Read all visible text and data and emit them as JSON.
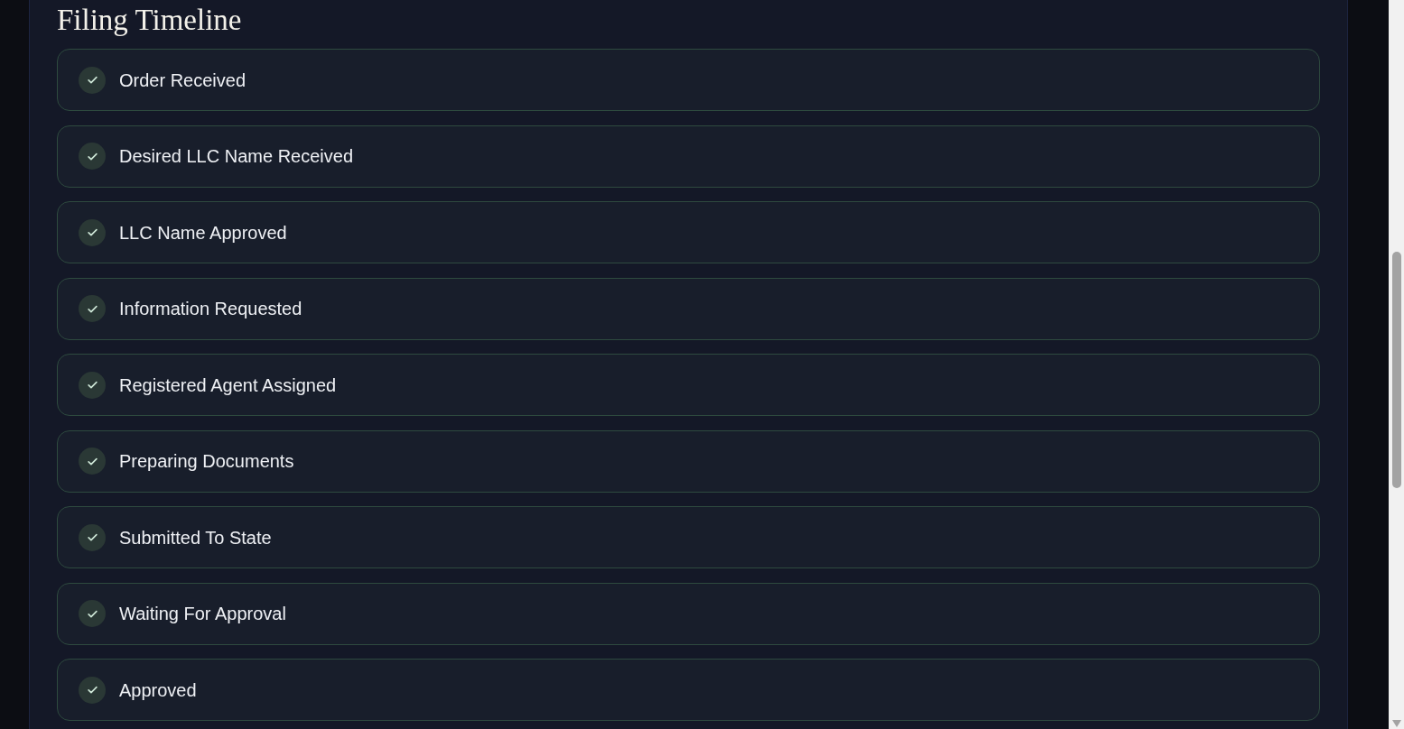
{
  "section": {
    "title": "Filing Timeline"
  },
  "steps": [
    {
      "label": "Order Received",
      "completed": true
    },
    {
      "label": "Desired LLC Name Received",
      "completed": true
    },
    {
      "label": "LLC Name Approved",
      "completed": true
    },
    {
      "label": "Information Requested",
      "completed": true
    },
    {
      "label": "Registered Agent Assigned",
      "completed": true
    },
    {
      "label": "Preparing Documents",
      "completed": true
    },
    {
      "label": "Submitted To State",
      "completed": true
    },
    {
      "label": "Waiting For Approval",
      "completed": true
    },
    {
      "label": "Approved",
      "completed": true
    }
  ]
}
